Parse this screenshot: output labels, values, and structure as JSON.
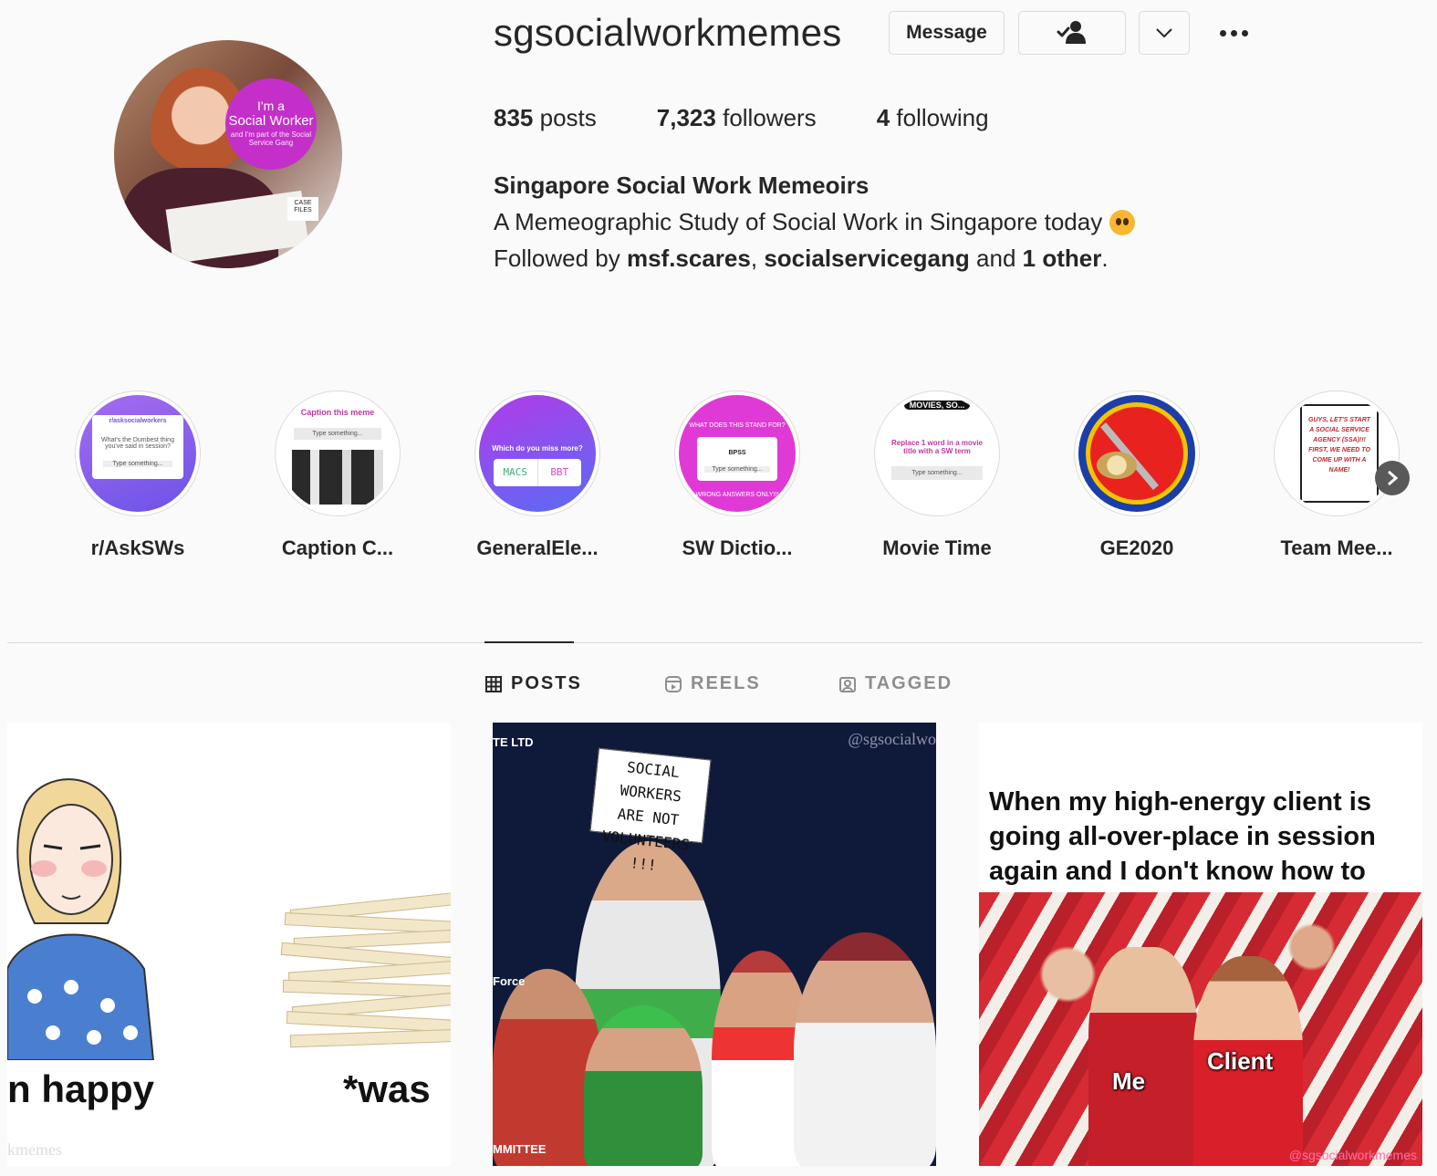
{
  "profile": {
    "username": "sgsocialworkmemes",
    "avatar_text": {
      "line1": "I'm a",
      "line2": "Social Worker",
      "line3": "and I'm part of the Social Service Gang",
      "tag": "CASE FILES"
    },
    "buttons": {
      "message": "Message",
      "follow_icon": "person-check-icon",
      "options_icon": "chevron-down-icon",
      "more_icon": "ellipsis-icon"
    },
    "stats": {
      "posts": {
        "count": "835",
        "label": "posts"
      },
      "followers": {
        "count": "7,323",
        "label": "followers"
      },
      "following": {
        "count": "4",
        "label": "following"
      }
    },
    "full_name": "Singapore Social Work Memeoirs",
    "bio": "A Memeographic Study of Social Work in Singapore today",
    "bio_emoji": "flushed-face-emoji",
    "followed_by": {
      "prefix": "Followed by",
      "user1": "msf.scares",
      "sep": ",",
      "user2": "socialservicegang",
      "and": "and",
      "others": "1 other",
      "end": "."
    }
  },
  "highlights": [
    {
      "label": "r/AskSWs",
      "cover": {
        "title": "r/asksocialworkers",
        "text": "What's the Dumbest thing you've said in session?",
        "input": "Type something..."
      }
    },
    {
      "label": "Caption C...",
      "cover": {
        "title": "Caption this meme",
        "input": "Type something..."
      }
    },
    {
      "label": "GeneralEle...",
      "cover": {
        "title": "Which do you miss more?",
        "opt1": "MACS",
        "opt2": "BBT"
      }
    },
    {
      "label": "SW Dictio...",
      "cover": {
        "title": "WHAT DOES THIS STAND FOR?",
        "term": "BPSS",
        "input": "Type something...",
        "footer": "WRONG ANSWERS ONLY!!!"
      }
    },
    {
      "label": "Movie Time",
      "cover": {
        "banner": "MOVIES, SO...",
        "title": "Replace 1 word in a movie title with a SW term",
        "input": "Type something..."
      }
    },
    {
      "label": "GE2020",
      "cover": {}
    },
    {
      "label": "Team Mee...",
      "cover": {
        "text": "GUYS, LET'S START A SOCIAL SERVICE AGENCY (SSA)!!! FIRST, WE NEED TO COME UP WITH A NAME!"
      }
    }
  ],
  "highlights_next_icon": "chevron-right-icon",
  "tabs": [
    {
      "label": "POSTS",
      "icon": "grid-icon",
      "active": true
    },
    {
      "label": "REELS",
      "icon": "reels-icon",
      "active": false
    },
    {
      "label": "TAGGED",
      "icon": "tagged-icon",
      "active": false
    }
  ],
  "posts": [
    {
      "text_left": "n happy",
      "text_right": "*was",
      "watermark": "kmemes"
    },
    {
      "sign": [
        "SOCIAL WORKERS",
        "ARE NOT",
        "VOLUNTEERS !!!"
      ],
      "top_label": "TE LTD",
      "side_label": "Force",
      "bottom_label": "MMITTEE",
      "watermark": "@sgsocialwo"
    },
    {
      "caption": "When my high-energy client is going all-over-place in session again and I don't know how to reply",
      "label_me": "Me",
      "label_client": "Client",
      "watermark": "@sgsocialworkmemes"
    }
  ],
  "colors": {
    "text": "#262626",
    "secondary": "#8e8e8e",
    "border": "#dbdbdb",
    "background": "#fafafa",
    "badge": "#c42fc9"
  }
}
